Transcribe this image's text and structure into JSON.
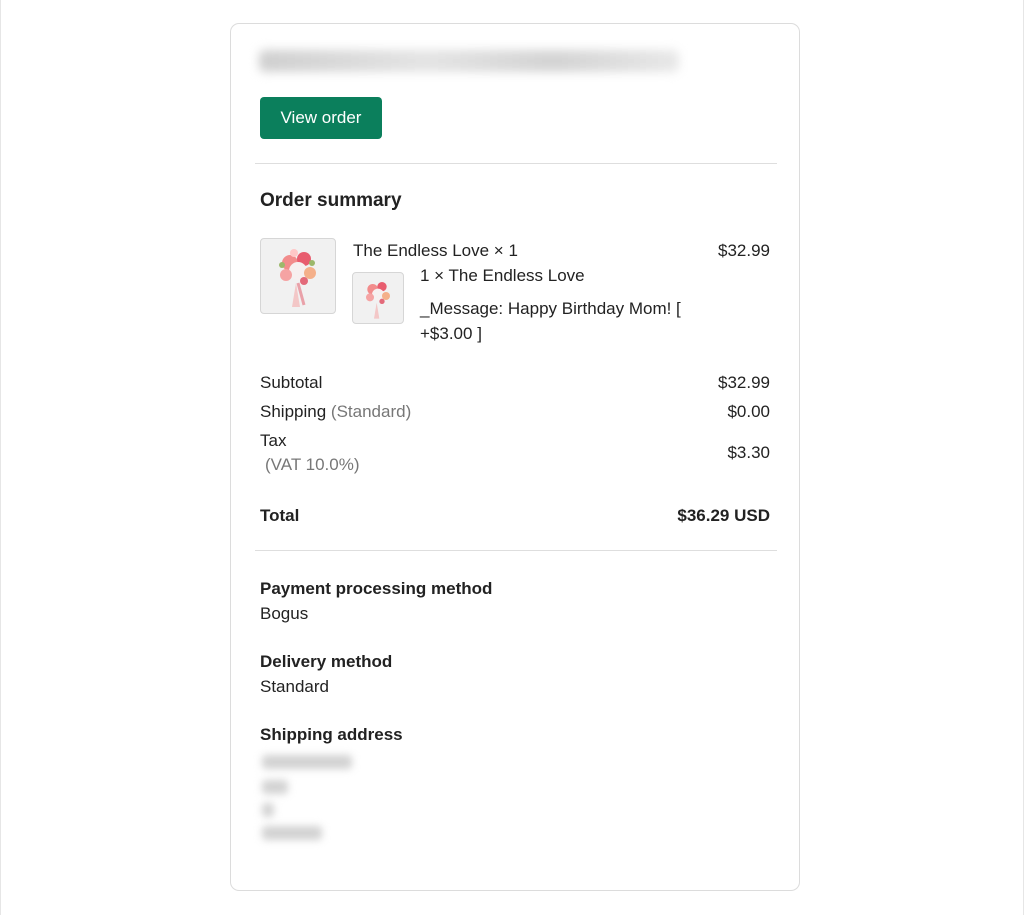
{
  "header": {
    "view_order_label": "View order"
  },
  "summary": {
    "title": "Order summary",
    "item": {
      "name": "The Endless Love × 1",
      "price": "$32.99",
      "sub_line": "1 × The Endless Love",
      "message": "_Message: Happy Birthday Mom! [ +$3.00 ]",
      "image_icon": "flower-bouquet-image"
    },
    "subtotal_label": "Subtotal",
    "subtotal_value": "$32.99",
    "shipping_label": "Shipping",
    "shipping_method": "(Standard)",
    "shipping_value": "$0.00",
    "tax_label": "Tax",
    "tax_detail": "(VAT 10.0%)",
    "tax_value": "$3.30",
    "total_label": "Total",
    "total_value": "$36.29 USD"
  },
  "details": {
    "payment_heading": "Payment processing method",
    "payment_value": "Bogus",
    "delivery_heading": "Delivery method",
    "delivery_value": "Standard",
    "shipping_address_heading": "Shipping address"
  },
  "colors": {
    "accent": "#0b7f5c",
    "muted_text": "#777777",
    "border": "#dcdcdc"
  }
}
